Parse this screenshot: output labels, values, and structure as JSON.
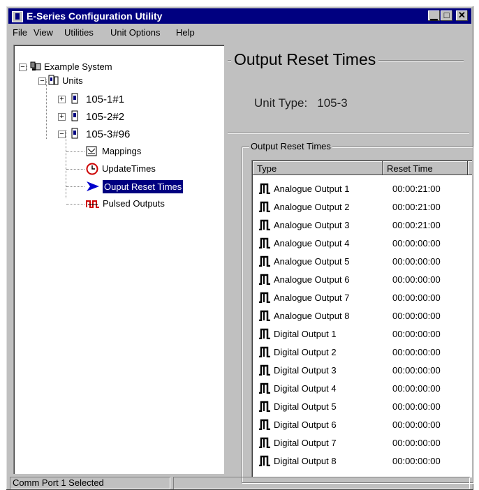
{
  "window": {
    "title": "E-Series Configuration Utility",
    "controls": {
      "minimize": "▁",
      "maximize": "□",
      "close": "✕"
    }
  },
  "menu": [
    "File",
    "View",
    "Utilities",
    "Unit Options",
    "Help"
  ],
  "tree": {
    "root": "Example System",
    "units_label": "Units",
    "units": [
      "105-1#1",
      "105-2#2",
      "105-3#96"
    ],
    "expander_plus": "+",
    "expander_minus": "−",
    "children": [
      "Mappings",
      "UpdateTimes",
      "Ouput Reset Times",
      "Pulsed Outputs"
    ],
    "selected": "Ouput Reset Times"
  },
  "panel": {
    "title": "Output Reset Times",
    "unit_type_label": "Unit Type:",
    "unit_type_value": "105-3",
    "group_label": "Output Reset Times",
    "columns": [
      "Type",
      "Reset Time"
    ],
    "rows": [
      {
        "type": "Analogue Output 1",
        "time": "00:00:21:00"
      },
      {
        "type": "Analogue Output 2",
        "time": "00:00:21:00"
      },
      {
        "type": "Analogue Output 3",
        "time": "00:00:21:00"
      },
      {
        "type": "Analogue Output 4",
        "time": "00:00:00:00"
      },
      {
        "type": "Analogue Output 5",
        "time": "00:00:00:00"
      },
      {
        "type": "Analogue Output 6",
        "time": "00:00:00:00"
      },
      {
        "type": "Analogue Output 7",
        "time": "00:00:00:00"
      },
      {
        "type": "Analogue Output 8",
        "time": "00:00:00:00"
      },
      {
        "type": "Digital Output 1",
        "time": "00:00:00:00"
      },
      {
        "type": "Digital Output 2",
        "time": "00:00:00:00"
      },
      {
        "type": "Digital Output 3",
        "time": "00:00:00:00"
      },
      {
        "type": "Digital Output 4",
        "time": "00:00:00:00"
      },
      {
        "type": "Digital Output 5",
        "time": "00:00:00:00"
      },
      {
        "type": "Digital Output 6",
        "time": "00:00:00:00"
      },
      {
        "type": "Digital Output 7",
        "time": "00:00:00:00"
      },
      {
        "type": "Digital Output 8",
        "time": "00:00:00:00"
      }
    ]
  },
  "status": {
    "left": "Comm Port 1 Selected",
    "right": ""
  },
  "colors": {
    "titlebar": "#000080",
    "face": "#c0c0c0",
    "selection": "#000080",
    "accent_red": "#cc0000"
  },
  "icons": {
    "root": "network-icon",
    "units": "units-icon",
    "unit": "unit-icon",
    "mappings": "mappings-icon",
    "update_times": "clock-icon",
    "reset_times": "arrow-icon",
    "pulsed": "pulse-icon",
    "row": "square-wave-icon"
  }
}
